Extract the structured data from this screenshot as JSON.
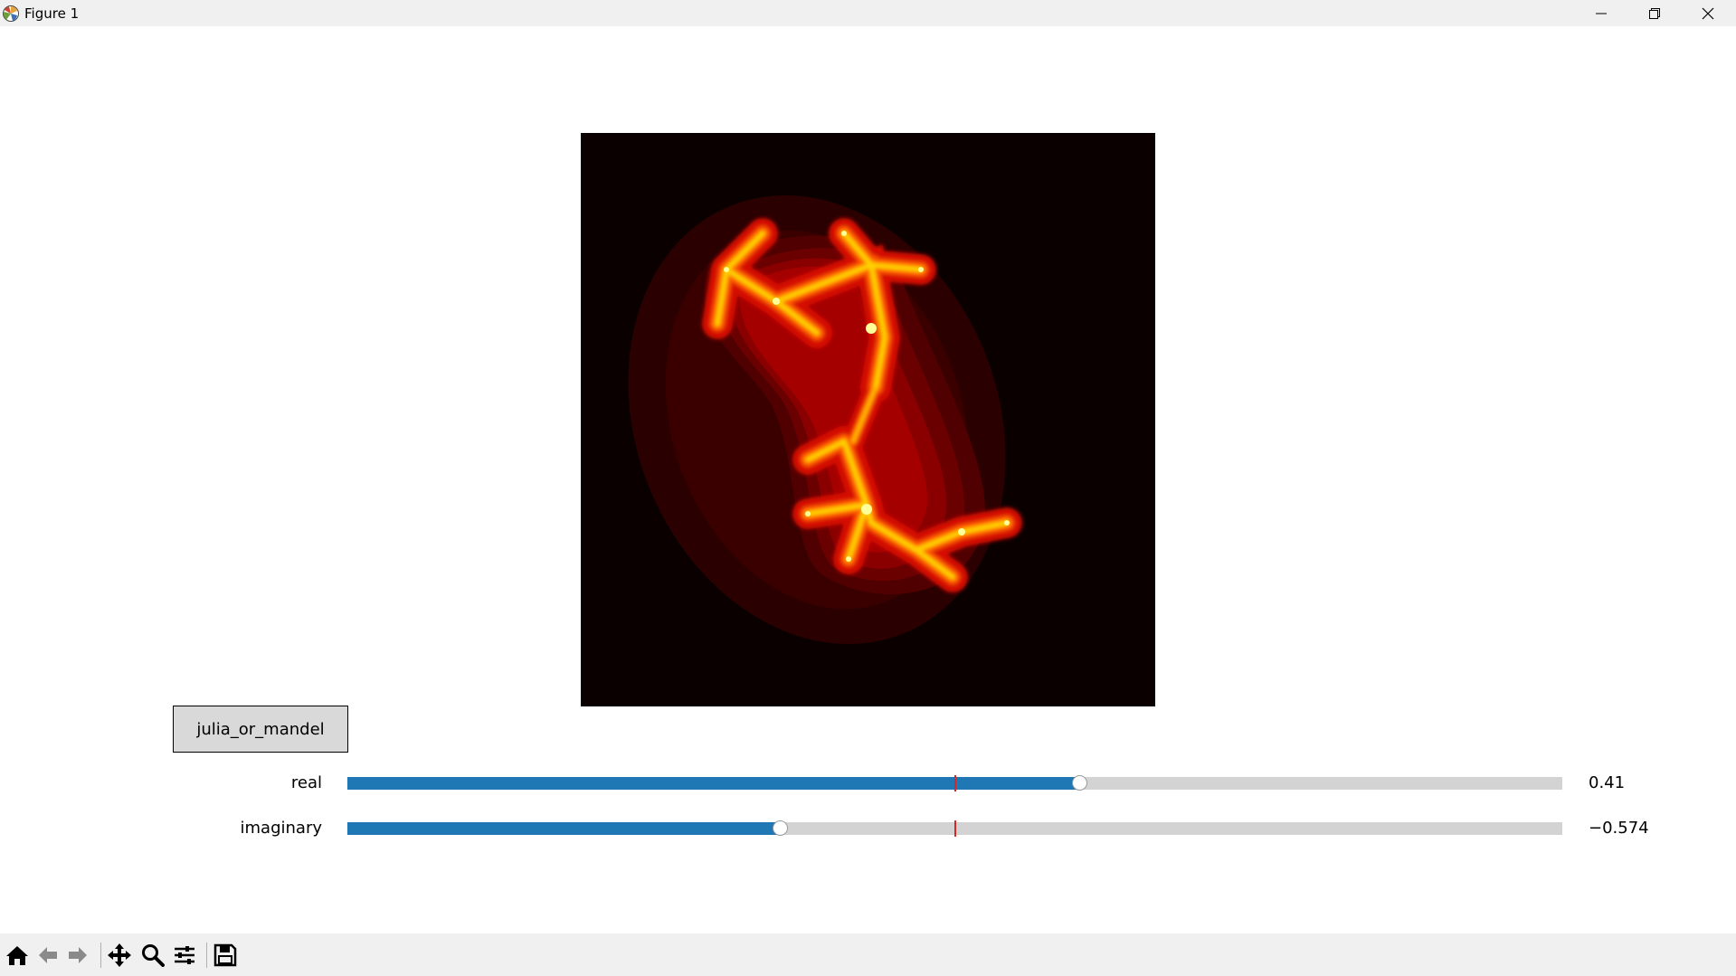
{
  "window": {
    "title": "Figure 1",
    "icons": [
      "matplotlib-icon",
      "minimize-icon",
      "restore-icon",
      "close-icon"
    ]
  },
  "figure": {
    "image": {
      "description_colormap": "hot",
      "colors": {
        "background": "#0b0000",
        "outer_rings": [
          "#2a0000",
          "#3c0000",
          "#550000",
          "#720000",
          "#960000",
          "#bb0000",
          "#e01400"
        ],
        "core": [
          "#ff3a00",
          "#ff8a00",
          "#ffd000",
          "#ffff80"
        ]
      }
    },
    "button": {
      "label": "julia_or_mandel"
    },
    "sliders": [
      {
        "label": "real",
        "value_text": "0.41",
        "fraction": 0.603,
        "init_fraction": 0.5
      },
      {
        "label": "imaginary",
        "value_text": "−0.574",
        "fraction": 0.357,
        "init_fraction": 0.5
      }
    ],
    "colors": {
      "slider_fill": "#1f77b4",
      "slider_track": "#d3d3d3",
      "init_line": "#d62728"
    }
  },
  "toolbar": {
    "tools": [
      "home-icon",
      "back-icon",
      "forward-icon",
      "pan-icon",
      "zoom-icon",
      "configure-subplots-icon",
      "save-icon"
    ]
  }
}
